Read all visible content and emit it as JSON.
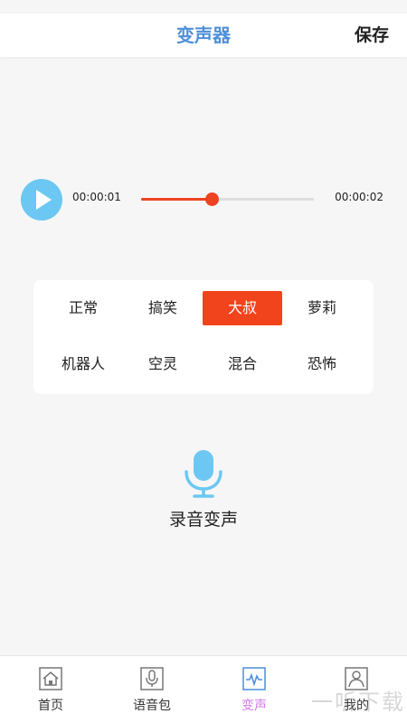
{
  "header": {
    "title": "变声器",
    "save_label": "保存"
  },
  "player": {
    "current_time": "00:00:01",
    "total_time": "00:00:02",
    "progress": 0.41,
    "play_icon": "play-icon",
    "colors": {
      "play_button": "#6cc8f2",
      "progress": "#ee4323"
    }
  },
  "effects": {
    "items": [
      {
        "label": "正常"
      },
      {
        "label": "搞笑"
      },
      {
        "label": "大叔"
      },
      {
        "label": "萝莉"
      },
      {
        "label": "机器人"
      },
      {
        "label": "空灵"
      },
      {
        "label": "混合"
      },
      {
        "label": "恐怖"
      }
    ],
    "selected": "大叔",
    "selected_color": "#f1431c"
  },
  "record": {
    "label": "录音变声",
    "icon": "microphone-icon",
    "icon_color": "#6cc8f2"
  },
  "nav": {
    "items": [
      {
        "label": "首页",
        "icon": "home-icon"
      },
      {
        "label": "语音包",
        "icon": "voice-pack-icon"
      },
      {
        "label": "变声",
        "icon": "voice-changer-icon",
        "active": true
      },
      {
        "label": "我的",
        "icon": "profile-icon"
      }
    ],
    "active_color": "#d37be9"
  },
  "watermark": "一听下载"
}
